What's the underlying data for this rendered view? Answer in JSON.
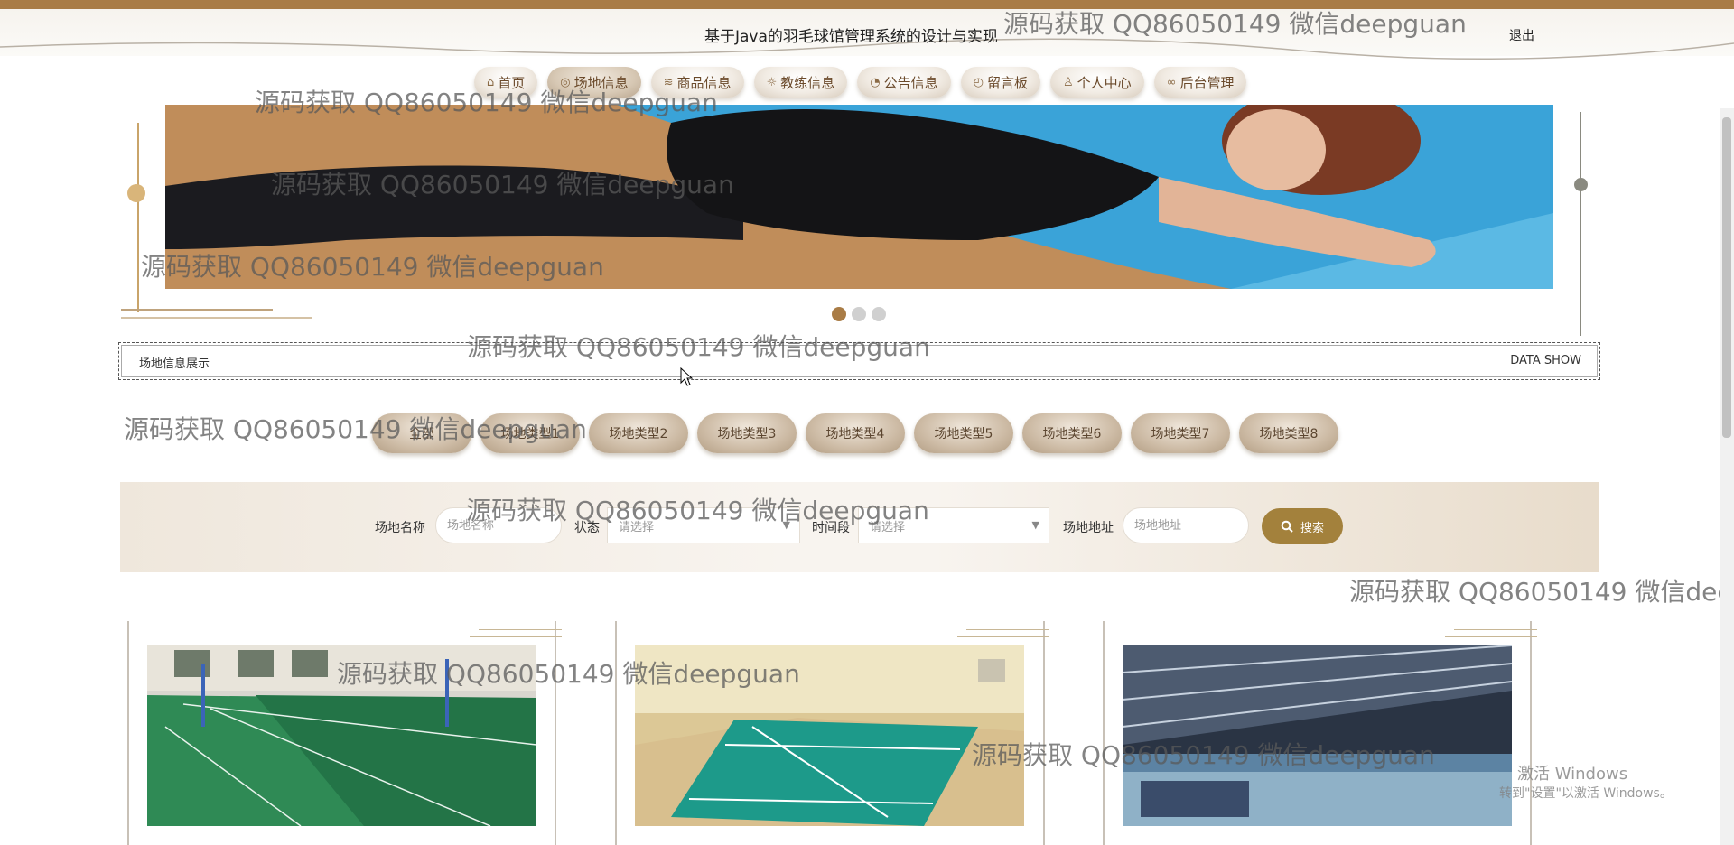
{
  "header": {
    "title": "基于Java的羽毛球馆管理系统的设计与实现",
    "logout": "退出"
  },
  "nav": [
    {
      "label": "首页",
      "icon": "home-icon",
      "glyph": "⌂"
    },
    {
      "label": "场地信息",
      "icon": "venue-icon",
      "glyph": "◎"
    },
    {
      "label": "商品信息",
      "icon": "stack-icon",
      "glyph": "≋"
    },
    {
      "label": "教练信息",
      "icon": "sun-icon",
      "glyph": "☼"
    },
    {
      "label": "公告信息",
      "icon": "palette-icon",
      "glyph": "◔"
    },
    {
      "label": "留言板",
      "icon": "gauge-icon",
      "glyph": "◴"
    },
    {
      "label": "个人中心",
      "icon": "user-icon",
      "glyph": "♙"
    },
    {
      "label": "后台管理",
      "icon": "link-icon",
      "glyph": "∞"
    }
  ],
  "carousel": {
    "slide_count": 3,
    "active_index": 0
  },
  "section": {
    "title": "场地信息展示",
    "subtitle": "DATA SHOW"
  },
  "categories": [
    "全部",
    "场地类型1",
    "场地类型2",
    "场地类型3",
    "场地类型4",
    "场地类型5",
    "场地类型6",
    "场地类型7",
    "场地类型8"
  ],
  "search": {
    "name_label": "场地名称",
    "name_placeholder": "场地名称",
    "status_label": "状态",
    "status_value": "请选择",
    "time_label": "时间段",
    "time_value": "请选择",
    "address_label": "场地地址",
    "address_placeholder": "场地地址",
    "button_label": "搜索"
  },
  "watermark": "源码获取 QQ86050149 微信deepguan",
  "windows_activation": {
    "line1": "激活 Windows",
    "line2": "转到\"设置\"以激活 Windows。"
  },
  "colors": {
    "accent": "#a97c46",
    "button": "#a3813c"
  }
}
